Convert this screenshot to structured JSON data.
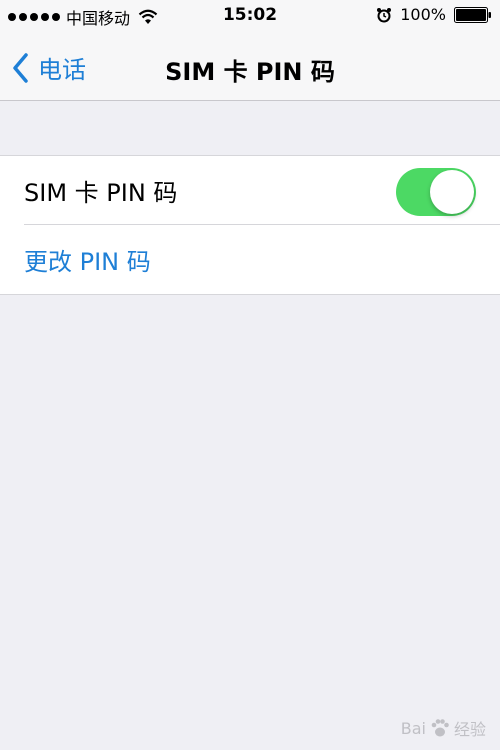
{
  "status_bar": {
    "carrier": "中国移动",
    "time": "15:02",
    "battery": "100%",
    "icons": [
      "signal-icon",
      "wifi-icon",
      "alarm-icon",
      "battery-icon"
    ]
  },
  "nav": {
    "back_label": "电话",
    "title": "SIM 卡 PIN 码"
  },
  "settings": {
    "sim_pin_label": "SIM 卡 PIN 码",
    "sim_pin_enabled": true,
    "change_pin_label": "更改 PIN 码"
  },
  "watermark": {
    "left": "Bai",
    "right": "经验"
  },
  "colors": {
    "accent": "#1e7fd6",
    "toggle_on": "#4cd964",
    "background": "#efeff4"
  }
}
